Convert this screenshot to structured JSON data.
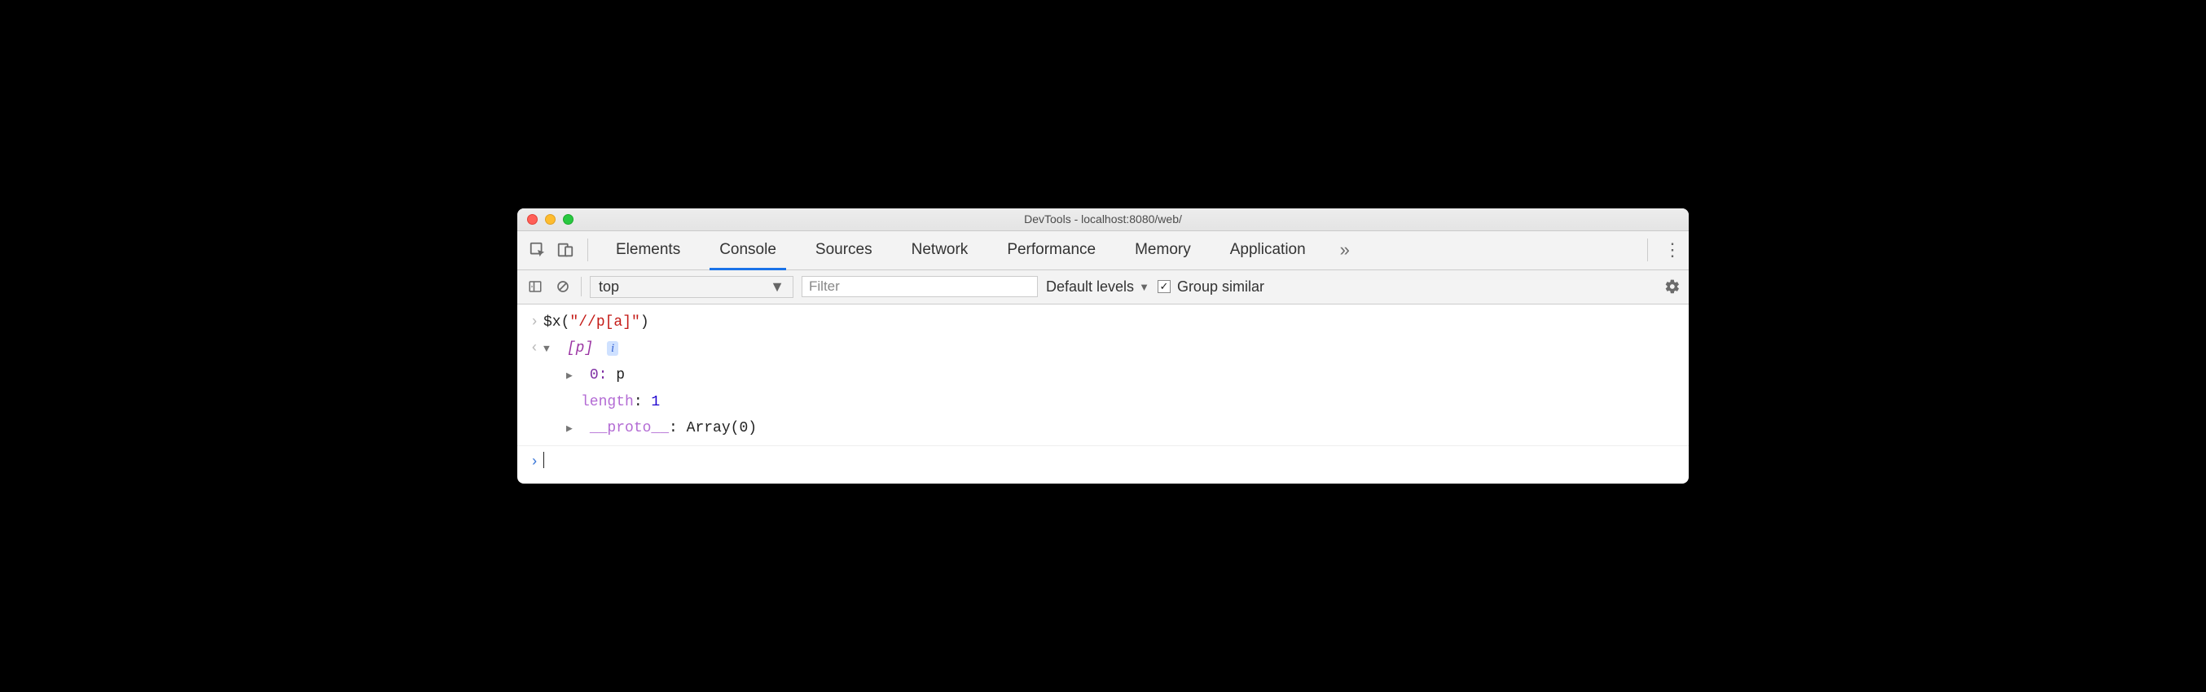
{
  "window": {
    "title": "DevTools - localhost:8080/web/"
  },
  "tabs": {
    "items": [
      "Elements",
      "Console",
      "Sources",
      "Network",
      "Performance",
      "Memory",
      "Application"
    ],
    "active_index": 1
  },
  "filter": {
    "context": "top",
    "placeholder": "Filter",
    "levels_label": "Default levels",
    "group_similar_label": "Group similar",
    "group_similar_checked": true
  },
  "console": {
    "input_fn": "$x",
    "input_arg": "\"//p[a]\"",
    "result_label": "[p]",
    "entry0_index": "0",
    "entry0_value": "p",
    "length_key": "length",
    "length_value": "1",
    "proto_key": "__proto__",
    "proto_value": "Array(0)"
  }
}
